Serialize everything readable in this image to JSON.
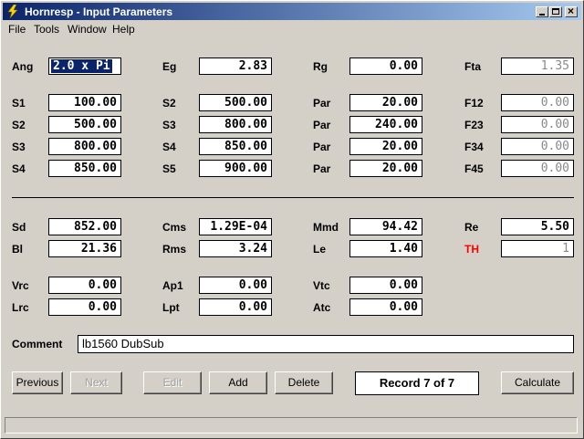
{
  "window": {
    "title": "Hornresp - Input Parameters"
  },
  "menu": [
    "File",
    "Tools",
    "Window",
    "Help"
  ],
  "fields": {
    "ang": {
      "label": "Ang",
      "value": "2.0 x Pi"
    },
    "eg": {
      "label": "Eg",
      "value": "2.83"
    },
    "rg": {
      "label": "Rg",
      "value": "0.00"
    },
    "fta": {
      "label": "Fta",
      "value": "1.35"
    },
    "s1": {
      "label": "S1",
      "value": "100.00"
    },
    "s2a": {
      "label": "S2",
      "value": "500.00"
    },
    "par1": {
      "label": "Par",
      "value": "20.00"
    },
    "f12": {
      "label": "F12",
      "value": "0.00"
    },
    "s2b": {
      "label": "S2",
      "value": "500.00"
    },
    "s3a": {
      "label": "S3",
      "value": "800.00"
    },
    "par2": {
      "label": "Par",
      "value": "240.00"
    },
    "f23": {
      "label": "F23",
      "value": "0.00"
    },
    "s3b": {
      "label": "S3",
      "value": "800.00"
    },
    "s4a": {
      "label": "S4",
      "value": "850.00"
    },
    "par3": {
      "label": "Par",
      "value": "20.00"
    },
    "f34": {
      "label": "F34",
      "value": "0.00"
    },
    "s4b": {
      "label": "S4",
      "value": "850.00"
    },
    "s5": {
      "label": "S5",
      "value": "900.00"
    },
    "par4": {
      "label": "Par",
      "value": "20.00"
    },
    "f45": {
      "label": "F45",
      "value": "0.00"
    },
    "sd": {
      "label": "Sd",
      "value": "852.00"
    },
    "cms": {
      "label": "Cms",
      "value": "1.29E-04"
    },
    "mmd": {
      "label": "Mmd",
      "value": "94.42"
    },
    "re": {
      "label": "Re",
      "value": "5.50"
    },
    "bl": {
      "label": "Bl",
      "value": "21.36"
    },
    "rms": {
      "label": "Rms",
      "value": "3.24"
    },
    "le": {
      "label": "Le",
      "value": "1.40"
    },
    "th": {
      "label": "TH",
      "value": "1"
    },
    "vrc": {
      "label": "Vrc",
      "value": "0.00"
    },
    "ap1": {
      "label": "Ap1",
      "value": "0.00"
    },
    "vtc": {
      "label": "Vtc",
      "value": "0.00"
    },
    "lrc": {
      "label": "Lrc",
      "value": "0.00"
    },
    "lpt": {
      "label": "Lpt",
      "value": "0.00"
    },
    "atc": {
      "label": "Atc",
      "value": "0.00"
    }
  },
  "comment": {
    "label": "Comment",
    "value": "lb1560 DubSub"
  },
  "buttons": {
    "previous": "Previous",
    "next": "Next",
    "edit": "Edit",
    "add": "Add",
    "delete": "Delete",
    "calculate": "Calculate"
  },
  "record": "Record 7 of 7",
  "colors": {
    "title_start": "#0a246a",
    "title_end": "#a6caf0",
    "th_label": "#ff0000"
  }
}
